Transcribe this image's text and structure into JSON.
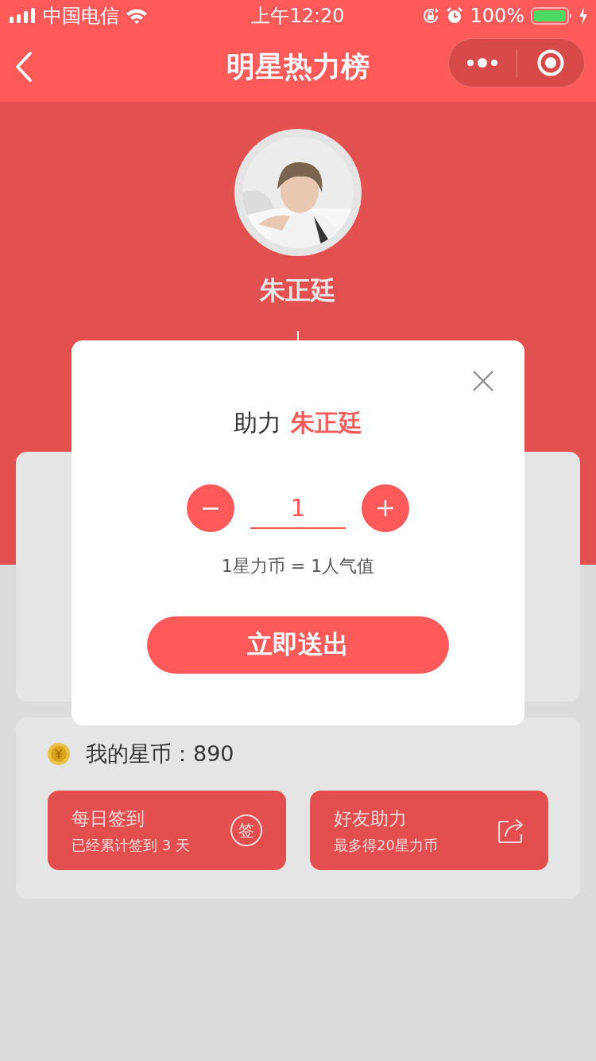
{
  "status_bar": {
    "carrier": "中国电信",
    "time": "上午12:20",
    "battery": "100%"
  },
  "nav": {
    "title": "明星热力榜"
  },
  "star": {
    "name": "朱正廷"
  },
  "wallet": {
    "label": "我的星币：890"
  },
  "actions": [
    {
      "kind": "checkin",
      "title": "每日签到",
      "subtitle": "已经累计签到 3 天",
      "icon_text": "签"
    },
    {
      "kind": "share",
      "title": "好友助力",
      "subtitle": "最多得20星力币"
    }
  ],
  "dialog": {
    "prefix": "助力",
    "star_name": "朱正廷",
    "quantity": "1",
    "rate": "1星力币 = 1人气值",
    "submit": "立即送出"
  }
}
